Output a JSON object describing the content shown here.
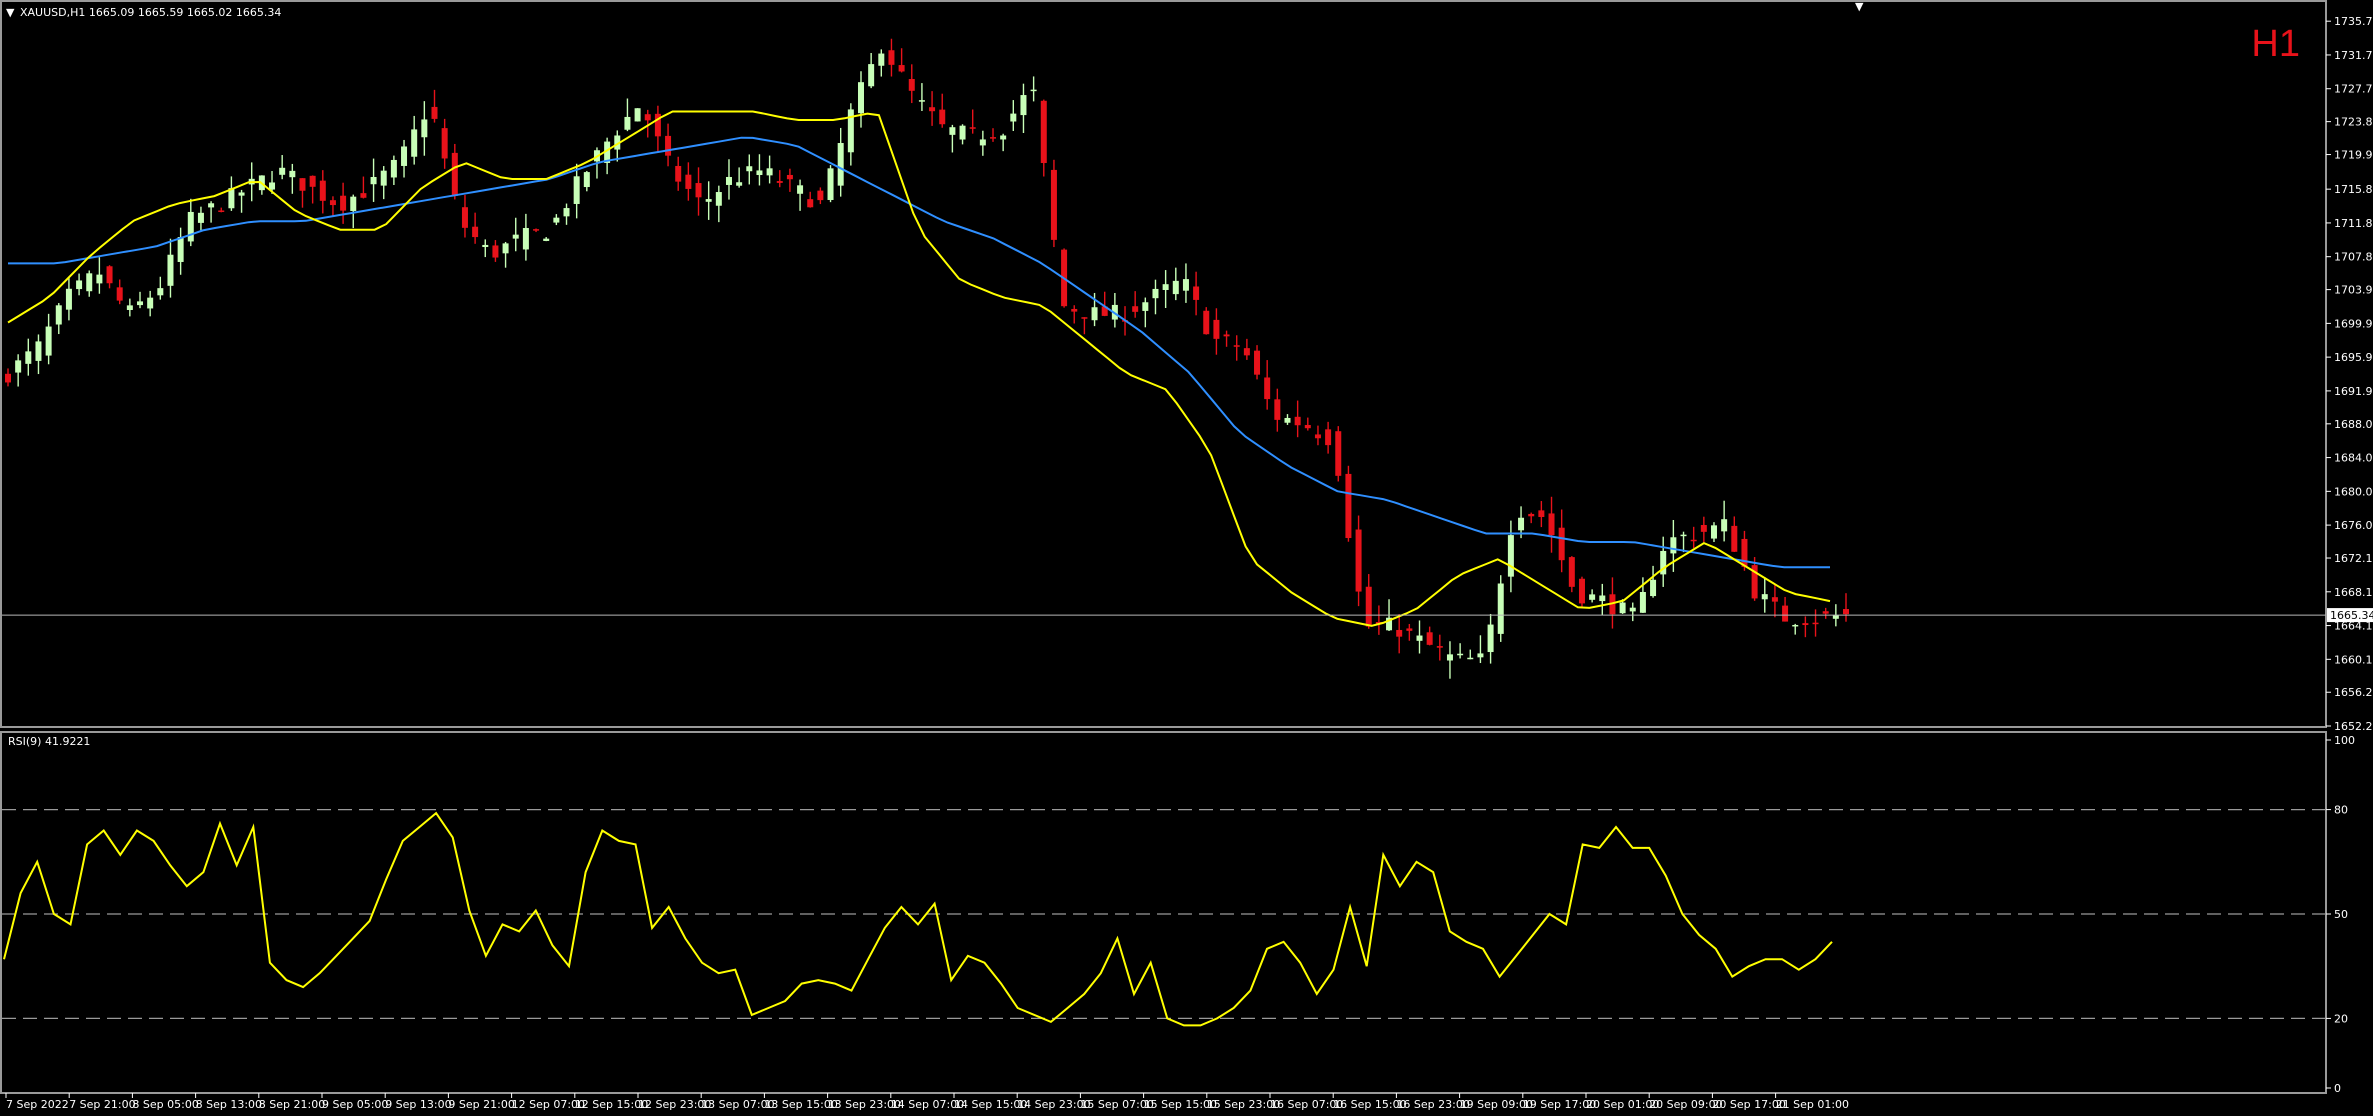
{
  "header": {
    "symbol_info": "XAUUSD,H1  1665.09 1665.59 1665.02 1665.34"
  },
  "timeframe_label": "H1",
  "current_price_label": "1665.34",
  "rsi_header": "RSI(9) 41.9221",
  "colors": {
    "background": "#000000",
    "bull": "#c8ffb8",
    "bear": "#e8121a",
    "ma_fast": "#ffff00",
    "ma_slow": "#2f8fff",
    "rsi": "#ffff00",
    "axis": "#ffffff",
    "timeframe": "#e8121a"
  },
  "chart_data": [
    {
      "type": "candlestick",
      "ylim": [
        1652.2,
        1737.5
      ],
      "y_ticks": [
        "1735.70",
        "1731.70",
        "1727.70",
        "1723.80",
        "1719.90",
        "1715.80",
        "1711.80",
        "1707.80",
        "1703.90",
        "1699.90",
        "1695.90",
        "1691.90",
        "1688.00",
        "1684.00",
        "1680.00",
        "1676.00",
        "1672.10",
        "1668.10",
        "1664.10",
        "1660.10",
        "1656.20",
        "1652.20"
      ],
      "x_labels": [
        "7 Sep 2022",
        "7 Sep 21:00",
        "8 Sep 05:00",
        "8 Sep 13:00",
        "8 Sep 21:00",
        "9 Sep 05:00",
        "9 Sep 13:00",
        "9 Sep 21:00",
        "12 Sep 07:00",
        "12 Sep 15:00",
        "12 Sep 23:00",
        "13 Sep 07:00",
        "13 Sep 15:00",
        "13 Sep 23:00",
        "14 Sep 07:00",
        "14 Sep 15:00",
        "14 Sep 23:00",
        "15 Sep 07:00",
        "15 Sep 15:00",
        "15 Sep 23:00",
        "16 Sep 07:00",
        "16 Sep 15:00",
        "16 Sep 23:00",
        "19 Sep 09:00",
        "19 Sep 17:00",
        "20 Sep 01:00",
        "20 Sep 09:00",
        "20 Sep 17:00",
        "21 Sep 01:00"
      ],
      "close_anchors": [
        1694,
        1697,
        1703,
        1706,
        1701,
        1704,
        1712,
        1714,
        1716,
        1718,
        1716,
        1714,
        1716,
        1719,
        1726,
        1712,
        1708,
        1710,
        1711,
        1717,
        1722,
        1726,
        1718,
        1714,
        1717,
        1718,
        1716,
        1714,
        1725,
        1733,
        1727,
        1723,
        1722,
        1723,
        1728,
        1702,
        1701,
        1701,
        1703,
        1705,
        1698,
        1697,
        1689,
        1688,
        1686,
        1664,
        1664,
        1662,
        1660,
        1660,
        1678,
        1677,
        1668,
        1667,
        1665,
        1674,
        1675,
        1676,
        1668,
        1665,
        1665,
        1665.34
      ],
      "ma_fast_anchors": [
        1700,
        1703,
        1708,
        1712,
        1714,
        1715,
        1717,
        1713,
        1711,
        1711,
        1716,
        1719,
        1717,
        1717,
        1719,
        1722,
        1725,
        1725,
        1725,
        1724,
        1724,
        1725,
        1711,
        1705,
        1703,
        1702,
        1698,
        1694,
        1692,
        1685,
        1672,
        1668,
        1665,
        1664,
        1666,
        1670,
        1672,
        1669,
        1666,
        1667,
        1671,
        1674,
        1671,
        1668,
        1667
      ],
      "ma_slow_anchors": [
        1707,
        1707,
        1708,
        1709,
        1711,
        1712,
        1712,
        1713,
        1714,
        1715,
        1716,
        1717,
        1719,
        1720,
        1721,
        1722,
        1721,
        1718,
        1715,
        1712,
        1710,
        1707,
        1703,
        1699,
        1694,
        1687,
        1683,
        1680,
        1679,
        1677,
        1675,
        1675,
        1674,
        1674,
        1673,
        1672,
        1671,
        1671
      ]
    },
    {
      "type": "line",
      "ylim": [
        0,
        100
      ],
      "y_ticks": [
        "100",
        "80",
        "50",
        "20",
        "0"
      ],
      "levels": [
        80,
        50,
        20
      ],
      "values": [
        37,
        56,
        65,
        50,
        47,
        70,
        74,
        67,
        74,
        71,
        64,
        58,
        62,
        76,
        64,
        75,
        36,
        31,
        29,
        33,
        38,
        43,
        48,
        60,
        71,
        75,
        79,
        72,
        51,
        38,
        47,
        45,
        51,
        41,
        35,
        62,
        74,
        71,
        70,
        46,
        52,
        43,
        36,
        33,
        34,
        21,
        23,
        25,
        30,
        31,
        30,
        28,
        37,
        46,
        52,
        47,
        53,
        31,
        38,
        36,
        30,
        23,
        21,
        19,
        23,
        27,
        33,
        43,
        27,
        36,
        20,
        18,
        18,
        20,
        23,
        28,
        40,
        42,
        36,
        27,
        34,
        52,
        35,
        67,
        58,
        65,
        62,
        45,
        42,
        40,
        32,
        38,
        44,
        50,
        47,
        70,
        69,
        75,
        69,
        69,
        61,
        50,
        44,
        40,
        32,
        35,
        37,
        37,
        34,
        37,
        42
      ]
    }
  ]
}
